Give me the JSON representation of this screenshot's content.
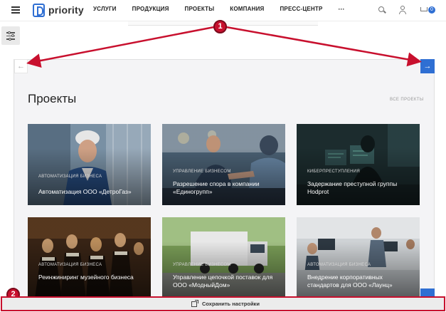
{
  "header": {
    "logo_text": "priority",
    "nav": [
      "УСЛУГИ",
      "ПРОДУКЦИЯ",
      "ПРОЕКТЫ",
      "КОМПАНИЯ",
      "ПРЕСС-ЦЕНТР"
    ],
    "more": "···",
    "cart_count": "0"
  },
  "slider": {
    "prev_arrow": "←",
    "next_arrow": "→"
  },
  "section": {
    "title": "Проекты",
    "all_link": "ВСЕ ПРОЕКТЫ"
  },
  "cards": [
    {
      "tag": "АВТОМАТИЗАЦИЯ БИЗНЕСА",
      "title": "Автоматизация ООО «ДетроГаз»",
      "image": "engineer-in-hardhat"
    },
    {
      "tag": "УПРАВЛЕНИЕ БИЗНЕСОМ",
      "title": "Разрешение спора в компании «Единогрупп»",
      "image": "business-handshake"
    },
    {
      "tag": "КИБЕРПРЕСТУПЛЕНИЯ",
      "title": "Задержание преступной группы Hodprot",
      "image": "hacker-monitors"
    },
    {
      "tag": "АВТОМАТИЗАЦИЯ БИЗНЕСА",
      "title": "Реинжиниринг музейного бизнеса",
      "image": "old-painting"
    },
    {
      "tag": "УПРАВЛЕНИЕ БИЗНЕСОМ",
      "title": "Управление цепочкой поставок для ООО «МодныйДом»",
      "image": "delivery-truck"
    },
    {
      "tag": "АВТОМАТИЗАЦИЯ БИЗНЕСА",
      "title": "Внедрение корпоративных стандартов для ООО «Лаунц»",
      "image": "open-office"
    }
  ],
  "annotations": [
    "1",
    "2"
  ],
  "save_bar": {
    "label": "Сохранить настройки"
  },
  "colors": {
    "accent": "#2f6fd3",
    "annotation": "#c8102e"
  }
}
